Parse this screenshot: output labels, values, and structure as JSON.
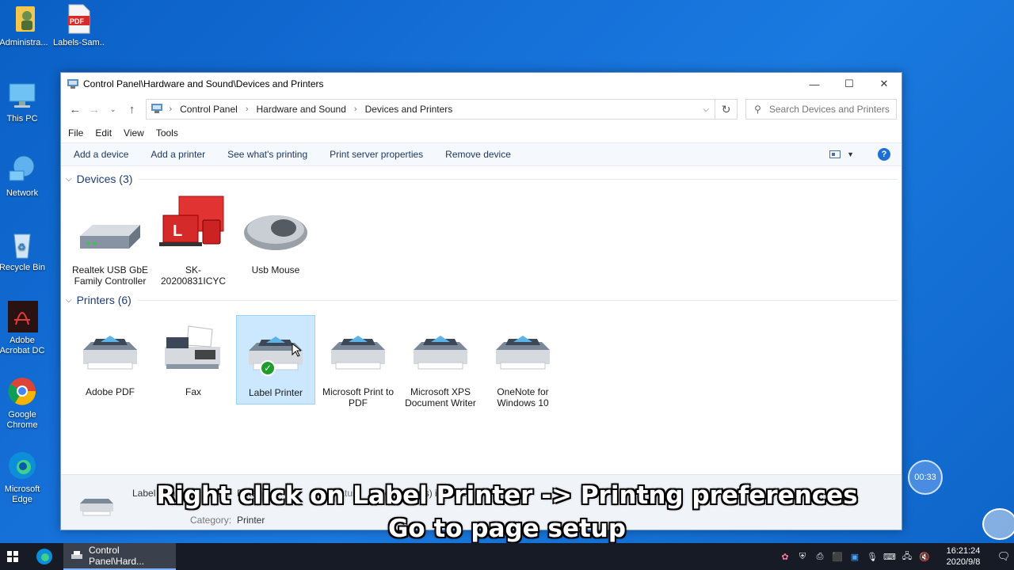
{
  "desktop": {
    "icons": [
      {
        "label": "Administra..."
      },
      {
        "label": "Labels-Sam..."
      },
      {
        "label": "This PC"
      },
      {
        "label": "Network"
      },
      {
        "label": "Recycle Bin"
      },
      {
        "label": "Adobe Acrobat DC"
      },
      {
        "label": "Google Chrome"
      },
      {
        "label": "Microsoft Edge"
      }
    ],
    "pdf_badge": "PDF"
  },
  "window": {
    "title": "Control Panel\\Hardware and Sound\\Devices and Printers",
    "address": {
      "crumbs": [
        "Control Panel",
        "Hardware and Sound",
        "Devices and Printers"
      ]
    },
    "search_placeholder": "Search Devices and Printers",
    "menu": [
      "File",
      "Edit",
      "View",
      "Tools"
    ],
    "commands": [
      "Add a device",
      "Add a printer",
      "See what's printing",
      "Print server properties",
      "Remove device"
    ],
    "help_label": "?",
    "groups": {
      "devices": {
        "header": "Devices (3)",
        "items": [
          {
            "label": "Realtek USB GbE Family Controller"
          },
          {
            "label": "SK-20200831ICYC"
          },
          {
            "label": "Usb Mouse"
          }
        ]
      },
      "printers": {
        "header": "Printers (6)",
        "items": [
          {
            "label": "Adobe PDF"
          },
          {
            "label": "Fax"
          },
          {
            "label": "Label Printer",
            "selected": true,
            "default": true
          },
          {
            "label": "Microsoft Print to PDF"
          },
          {
            "label": "Microsoft XPS Document Writer"
          },
          {
            "label": "OneNote for Windows 10"
          }
        ]
      }
    },
    "details": {
      "name": "Label Printer",
      "state_label": "State:",
      "state_value": "Default",
      "status_label": "Status:",
      "status_value": "0 document(s) in queue",
      "category_label": "Category:",
      "category_value": "Printer"
    }
  },
  "overlay": {
    "caption_line1": "Right click on Label Printer -> Printng preferences",
    "caption_line2": "Go to page setup",
    "timer": "00:33"
  },
  "taskbar": {
    "active_task": "Control Panel\\Hard...",
    "time": "16:21:24",
    "date": "2020/9/8"
  },
  "colors": {
    "accent": "#1f6fd6",
    "selection": "#cce8ff",
    "desktop": "#1570d8"
  }
}
